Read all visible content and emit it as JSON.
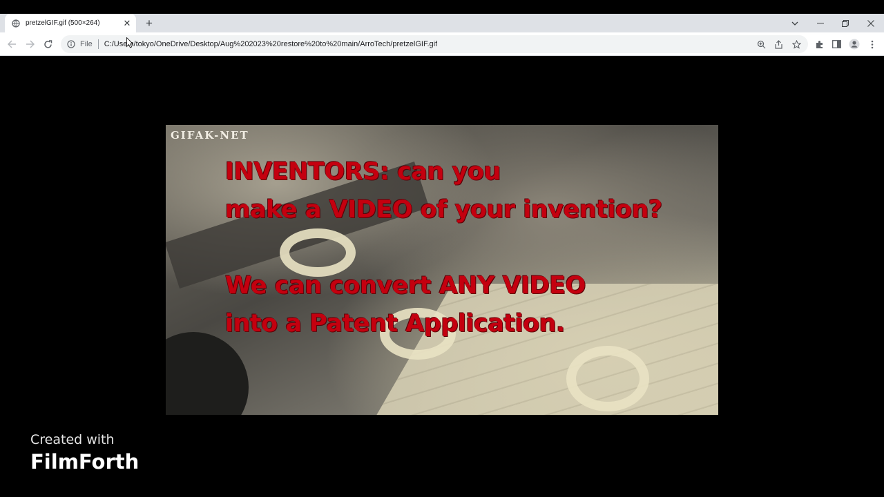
{
  "browser": {
    "tab": {
      "title": "pretzelGIF.gif (500×264)"
    },
    "address": {
      "scheme_label": "File",
      "url": "C:/Users/tokyo/OneDrive/Desktop/Aug%202023%20restore%20to%20main/ArroTech/pretzelGIF.gif"
    }
  },
  "gif": {
    "watermark": "GIFAK-NET",
    "lines": [
      "INVENTORS: can you",
      "make a VIDEO of your invention?",
      "We can convert ANY VIDEO",
      "into a Patent Application."
    ],
    "text_color": "#c4000f"
  },
  "credit": {
    "line1": "Created with",
    "line2": "FilmForth"
  }
}
